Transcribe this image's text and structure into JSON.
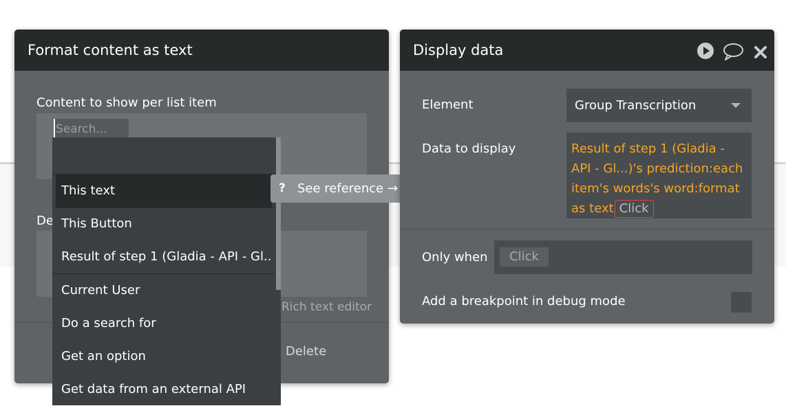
{
  "left_panel": {
    "title": "Format content as text",
    "content_label": "Content to show per list item",
    "second_label": "De",
    "rich_text_link": "Rich text editor",
    "delete_label": "Delete"
  },
  "dropdown": {
    "search_placeholder": "Search...",
    "items": [
      "This text",
      "This Button",
      "Result of step 1 (Gladia - API - Gl...)",
      "Current User",
      "Do a search for",
      "Get an option",
      "Get data from an external API"
    ],
    "selected_index": 0
  },
  "tooltip": {
    "icon": "?",
    "text": "See reference →"
  },
  "right_panel": {
    "title": "Display data",
    "icons": [
      "play-icon",
      "comment-icon",
      "close-icon"
    ],
    "element_label": "Element",
    "element_value": "Group Transcription",
    "data_label": "Data to display",
    "data_expression": "Result of step 1 (Gladia - API - Gl...)'s prediction:each item's words's word:format as text",
    "data_click_chip": "Click",
    "only_when_label": "Only when",
    "only_when_chip": "Click",
    "breakpoint_label": "Add a breakpoint in debug mode"
  },
  "colors": {
    "panel": "#5f6366",
    "header": "#262a2b",
    "expression": "#f5a623",
    "chip_border": "#e2434b"
  }
}
